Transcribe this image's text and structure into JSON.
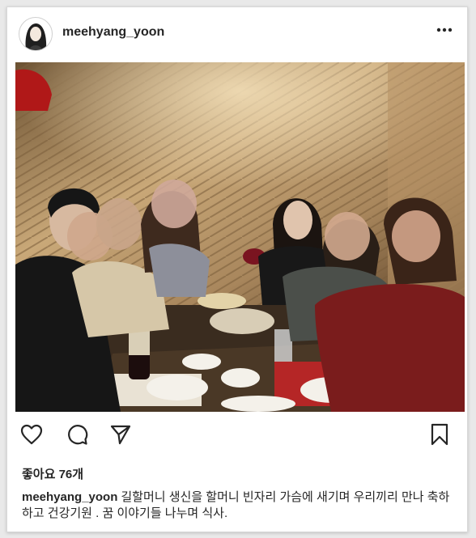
{
  "post": {
    "username": "meehyang_yoon",
    "likes_text": "좋아요 76개",
    "caption_text": "길할머니 생신을 할머니 빈자리 가슴에 새기며 우리끼리 만나 축하하고 건강기원 . 꿈 이야기들 나누며 식사."
  },
  "icons": {
    "more": "more-options-icon",
    "like": "heart-icon",
    "comment": "comment-icon",
    "share": "send-icon",
    "save": "bookmark-icon"
  },
  "colors": {
    "text": "#262626",
    "background": "#ffffff"
  }
}
